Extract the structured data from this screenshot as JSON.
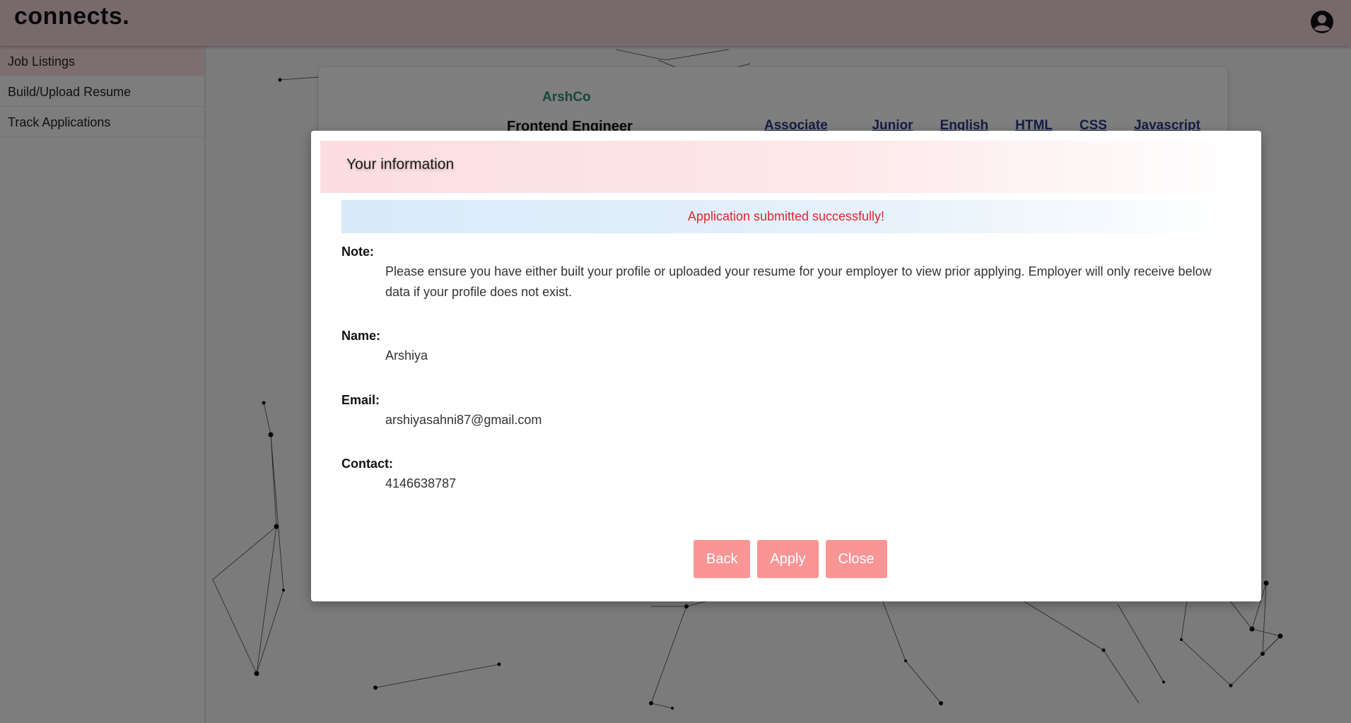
{
  "app": {
    "brand": "connects."
  },
  "sidebar": {
    "items": [
      {
        "label": "Job Listings"
      },
      {
        "label": "Build/Upload Resume"
      },
      {
        "label": "Track Applications"
      }
    ]
  },
  "job": {
    "company": "ArshCo",
    "title": "Frontend Engineer",
    "tags": [
      "Associate Engineer",
      "Junior",
      "English",
      "HTML",
      "CSS",
      "Javascript"
    ]
  },
  "modal": {
    "title": "Your information",
    "alert": "Application submitted successfully!",
    "note_label": "Note:",
    "note_text": "Please ensure you have either built your profile or uploaded your resume for your employer to view prior applying. Employer will only receive below data if your profile does not exist.",
    "name_label": "Name:",
    "name_value": "Arshiya",
    "email_label": "Email:",
    "email_value": "arshiyasahni87@gmail.com",
    "contact_label": "Contact:",
    "contact_value": "4146638787",
    "buttons": {
      "back": "Back",
      "apply": "Apply",
      "close": "Close"
    }
  },
  "colors": {
    "topbar": "#f0d4d8",
    "active_sidebar": "#fbdfe2",
    "button": "#f99595",
    "alert_text": "#e0262e",
    "company": "#2f8e7a",
    "tag": "#2d3a8c"
  }
}
